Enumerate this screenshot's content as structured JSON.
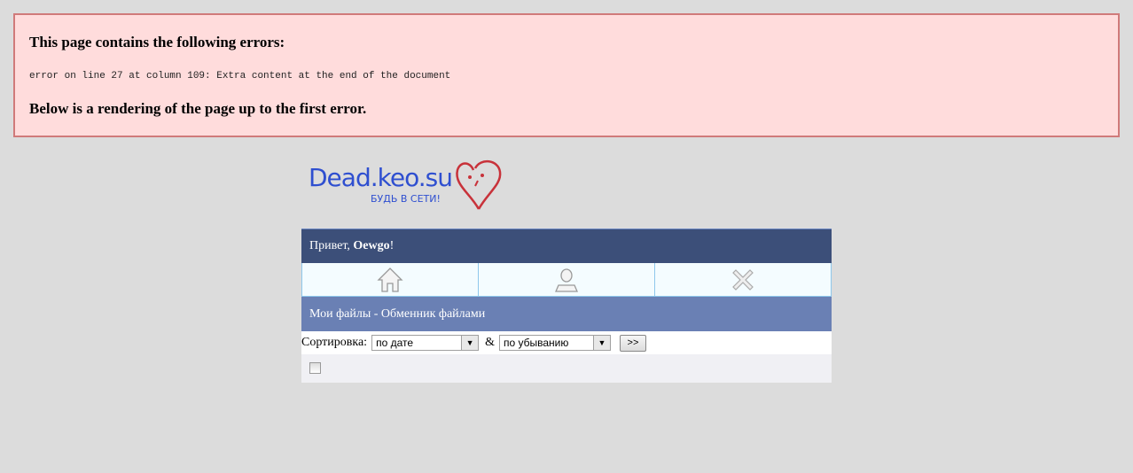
{
  "error_box": {
    "heading": "This page contains the following errors:",
    "message": "error on line 27 at column 109: Extra content at the end of the document",
    "footer": "Below is a rendering of the page up to the first error."
  },
  "logo": {
    "name": "Dead.keo.su",
    "slogan": "БУДЬ В СЕТИ!"
  },
  "header": {
    "greeting": "Привет, ",
    "username": "Oewgo",
    "exclaim": "!"
  },
  "nav": [
    {
      "icon": "home-icon"
    },
    {
      "icon": "user-icon"
    },
    {
      "icon": "close-icon"
    }
  ],
  "section_title": "Мои файлы - Обменник файлами",
  "sort": {
    "label": "Сортировка:",
    "field": "по дате",
    "connector": "&",
    "order": "по убыванию",
    "submit": ">>"
  }
}
